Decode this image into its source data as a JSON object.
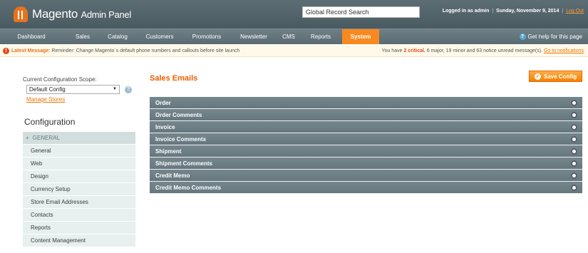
{
  "header": {
    "logo_main": "Magento",
    "logo_sub": "Admin Panel",
    "search_value": "Global Record Search",
    "logged_in": "Logged in as admin",
    "date": "Sunday, November 9, 2014",
    "logout": "Log Out"
  },
  "nav": {
    "items": [
      "Dashboard",
      "Sales",
      "Catalog",
      "Customers",
      "Promotions",
      "Newsletter",
      "CMS",
      "Reports",
      "System"
    ],
    "active": "System",
    "help": "Get help for this page"
  },
  "message": {
    "label": "Latest Message:",
    "text": "Reminder: Change Magento`s default phone numbers and callouts before site launch",
    "right_prefix": "You have",
    "critical": "2 critical",
    "right_rest": ", 6 major, 19 minor and 63 notice unread message(s).",
    "link": "Go to notifications"
  },
  "sidebar": {
    "scope_label": "Current Configuration Scope:",
    "scope_value": "Default Config",
    "manage_stores": "Manage Stores",
    "config_title": "Configuration",
    "group": "GENERAL",
    "items": [
      "General",
      "Web",
      "Design",
      "Currency Setup",
      "Store Email Addresses",
      "Contacts",
      "Reports",
      "Content Management"
    ]
  },
  "main": {
    "title": "Sales Emails",
    "save_button": "Save Config",
    "sections": [
      "Order",
      "Order Comments",
      "Invoice",
      "Invoice Comments",
      "Shipment",
      "Shipment Comments",
      "Credit Memo",
      "Credit Memo Comments"
    ]
  },
  "icons": {
    "logo": "magento-logo-icon",
    "help": "help-icon",
    "alert": "alert-icon",
    "save": "save-icon",
    "toggle": "expand-toggle-icon"
  },
  "colors": {
    "accent": "#f78920",
    "header_bg": "#4a5a61",
    "title": "#eb5e00",
    "section_bar": "#6b7c83"
  }
}
